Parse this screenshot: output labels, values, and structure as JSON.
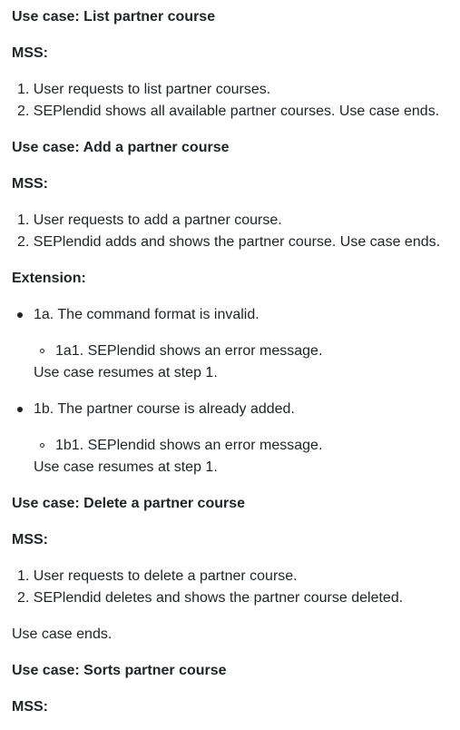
{
  "sections": [
    {
      "heading": "Use case: List partner course",
      "mss_label": "MSS:",
      "steps": [
        "1. User requests to list partner courses.",
        "2. SEPlendid shows all available partner courses. Use case ends."
      ]
    },
    {
      "heading": "Use case: Add a partner course",
      "mss_label": "MSS:",
      "steps": [
        "1. User requests to add a partner course.",
        "2. SEPlendid adds and shows the partner course. Use case ends."
      ],
      "extension_label": "Extension:",
      "extensions": [
        {
          "item": "1a. The command format is invalid.",
          "sub": "1a1. SEPlendid shows an error message.",
          "resume": "Use case resumes at step 1."
        },
        {
          "item": "1b. The partner course is already added.",
          "sub": "1b1. SEPlendid shows an error message.",
          "resume": "Use case resumes at step 1."
        }
      ]
    },
    {
      "heading": "Use case: Delete a partner course",
      "mss_label": "MSS:",
      "steps": [
        "1. User requests to delete a partner course.",
        "2. SEPlendid deletes and shows the partner course deleted."
      ],
      "trailer": "Use case ends."
    },
    {
      "heading": "Use case: Sorts partner course",
      "mss_label": "MSS:"
    }
  ]
}
